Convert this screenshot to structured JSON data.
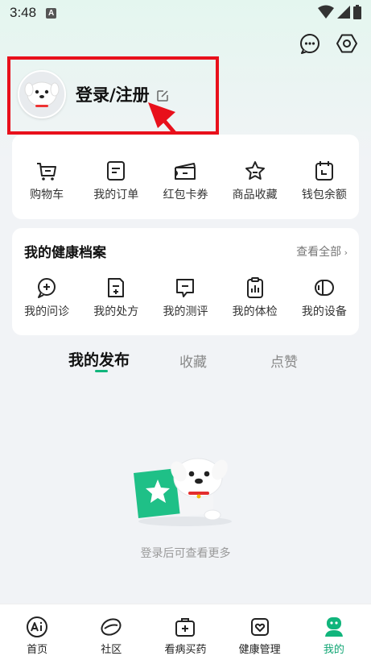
{
  "status_bar": {
    "time": "3:48",
    "notification_badge": "A"
  },
  "header": {
    "icons": [
      "message-icon",
      "settings-icon"
    ]
  },
  "profile": {
    "login_label": "登录/注册"
  },
  "quick_actions": [
    {
      "label": "购物车",
      "icon": "cart-icon"
    },
    {
      "label": "我的订单",
      "icon": "order-icon"
    },
    {
      "label": "红包卡券",
      "icon": "coupon-icon"
    },
    {
      "label": "商品收藏",
      "icon": "star-icon"
    },
    {
      "label": "钱包余额",
      "icon": "wallet-icon"
    }
  ],
  "health_records": {
    "title": "我的健康档案",
    "view_all": "查看全部",
    "items": [
      {
        "label": "我的问诊",
        "icon": "consult-icon"
      },
      {
        "label": "我的处方",
        "icon": "prescription-icon"
      },
      {
        "label": "我的测评",
        "icon": "assessment-icon"
      },
      {
        "label": "我的体检",
        "icon": "checkup-icon"
      },
      {
        "label": "我的设备",
        "icon": "device-icon"
      }
    ]
  },
  "content_tabs": [
    {
      "label": "我的发布",
      "active": true
    },
    {
      "label": "收藏",
      "active": false
    },
    {
      "label": "点赞",
      "active": false
    }
  ],
  "empty_state": {
    "text": "登录后可查看更多"
  },
  "bottom_nav": [
    {
      "label": "首页",
      "icon": "home-ai-icon",
      "active": false
    },
    {
      "label": "社区",
      "icon": "community-icon",
      "active": false
    },
    {
      "label": "看病买药",
      "icon": "medical-kit-icon",
      "active": false
    },
    {
      "label": "健康管理",
      "icon": "health-manage-icon",
      "active": false
    },
    {
      "label": "我的",
      "icon": "profile-icon",
      "active": true
    }
  ],
  "colors": {
    "accent": "#11b57c",
    "annotation": "#e8101b",
    "background": "#f1f3f6"
  }
}
